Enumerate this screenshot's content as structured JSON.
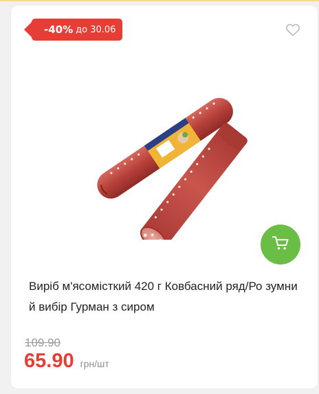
{
  "product": {
    "title": "Виріб м'ясомісткий 420 г Ковбасний ряд/Ро зумний вибір Гурман з сиром",
    "image_alt": "sausage-product-image"
  },
  "badge": {
    "percent": "-40%",
    "until": "до 30.06"
  },
  "price": {
    "old": "109.90",
    "new": "65.90",
    "unit": "грн/шт"
  },
  "icons": {
    "favorite": "heart-outline-icon",
    "cart": "shopping-cart-icon"
  },
  "colors": {
    "accent_red": "#e73d37",
    "cart_green": "#6abd45",
    "old_price_gray": "#9a9a9a"
  }
}
